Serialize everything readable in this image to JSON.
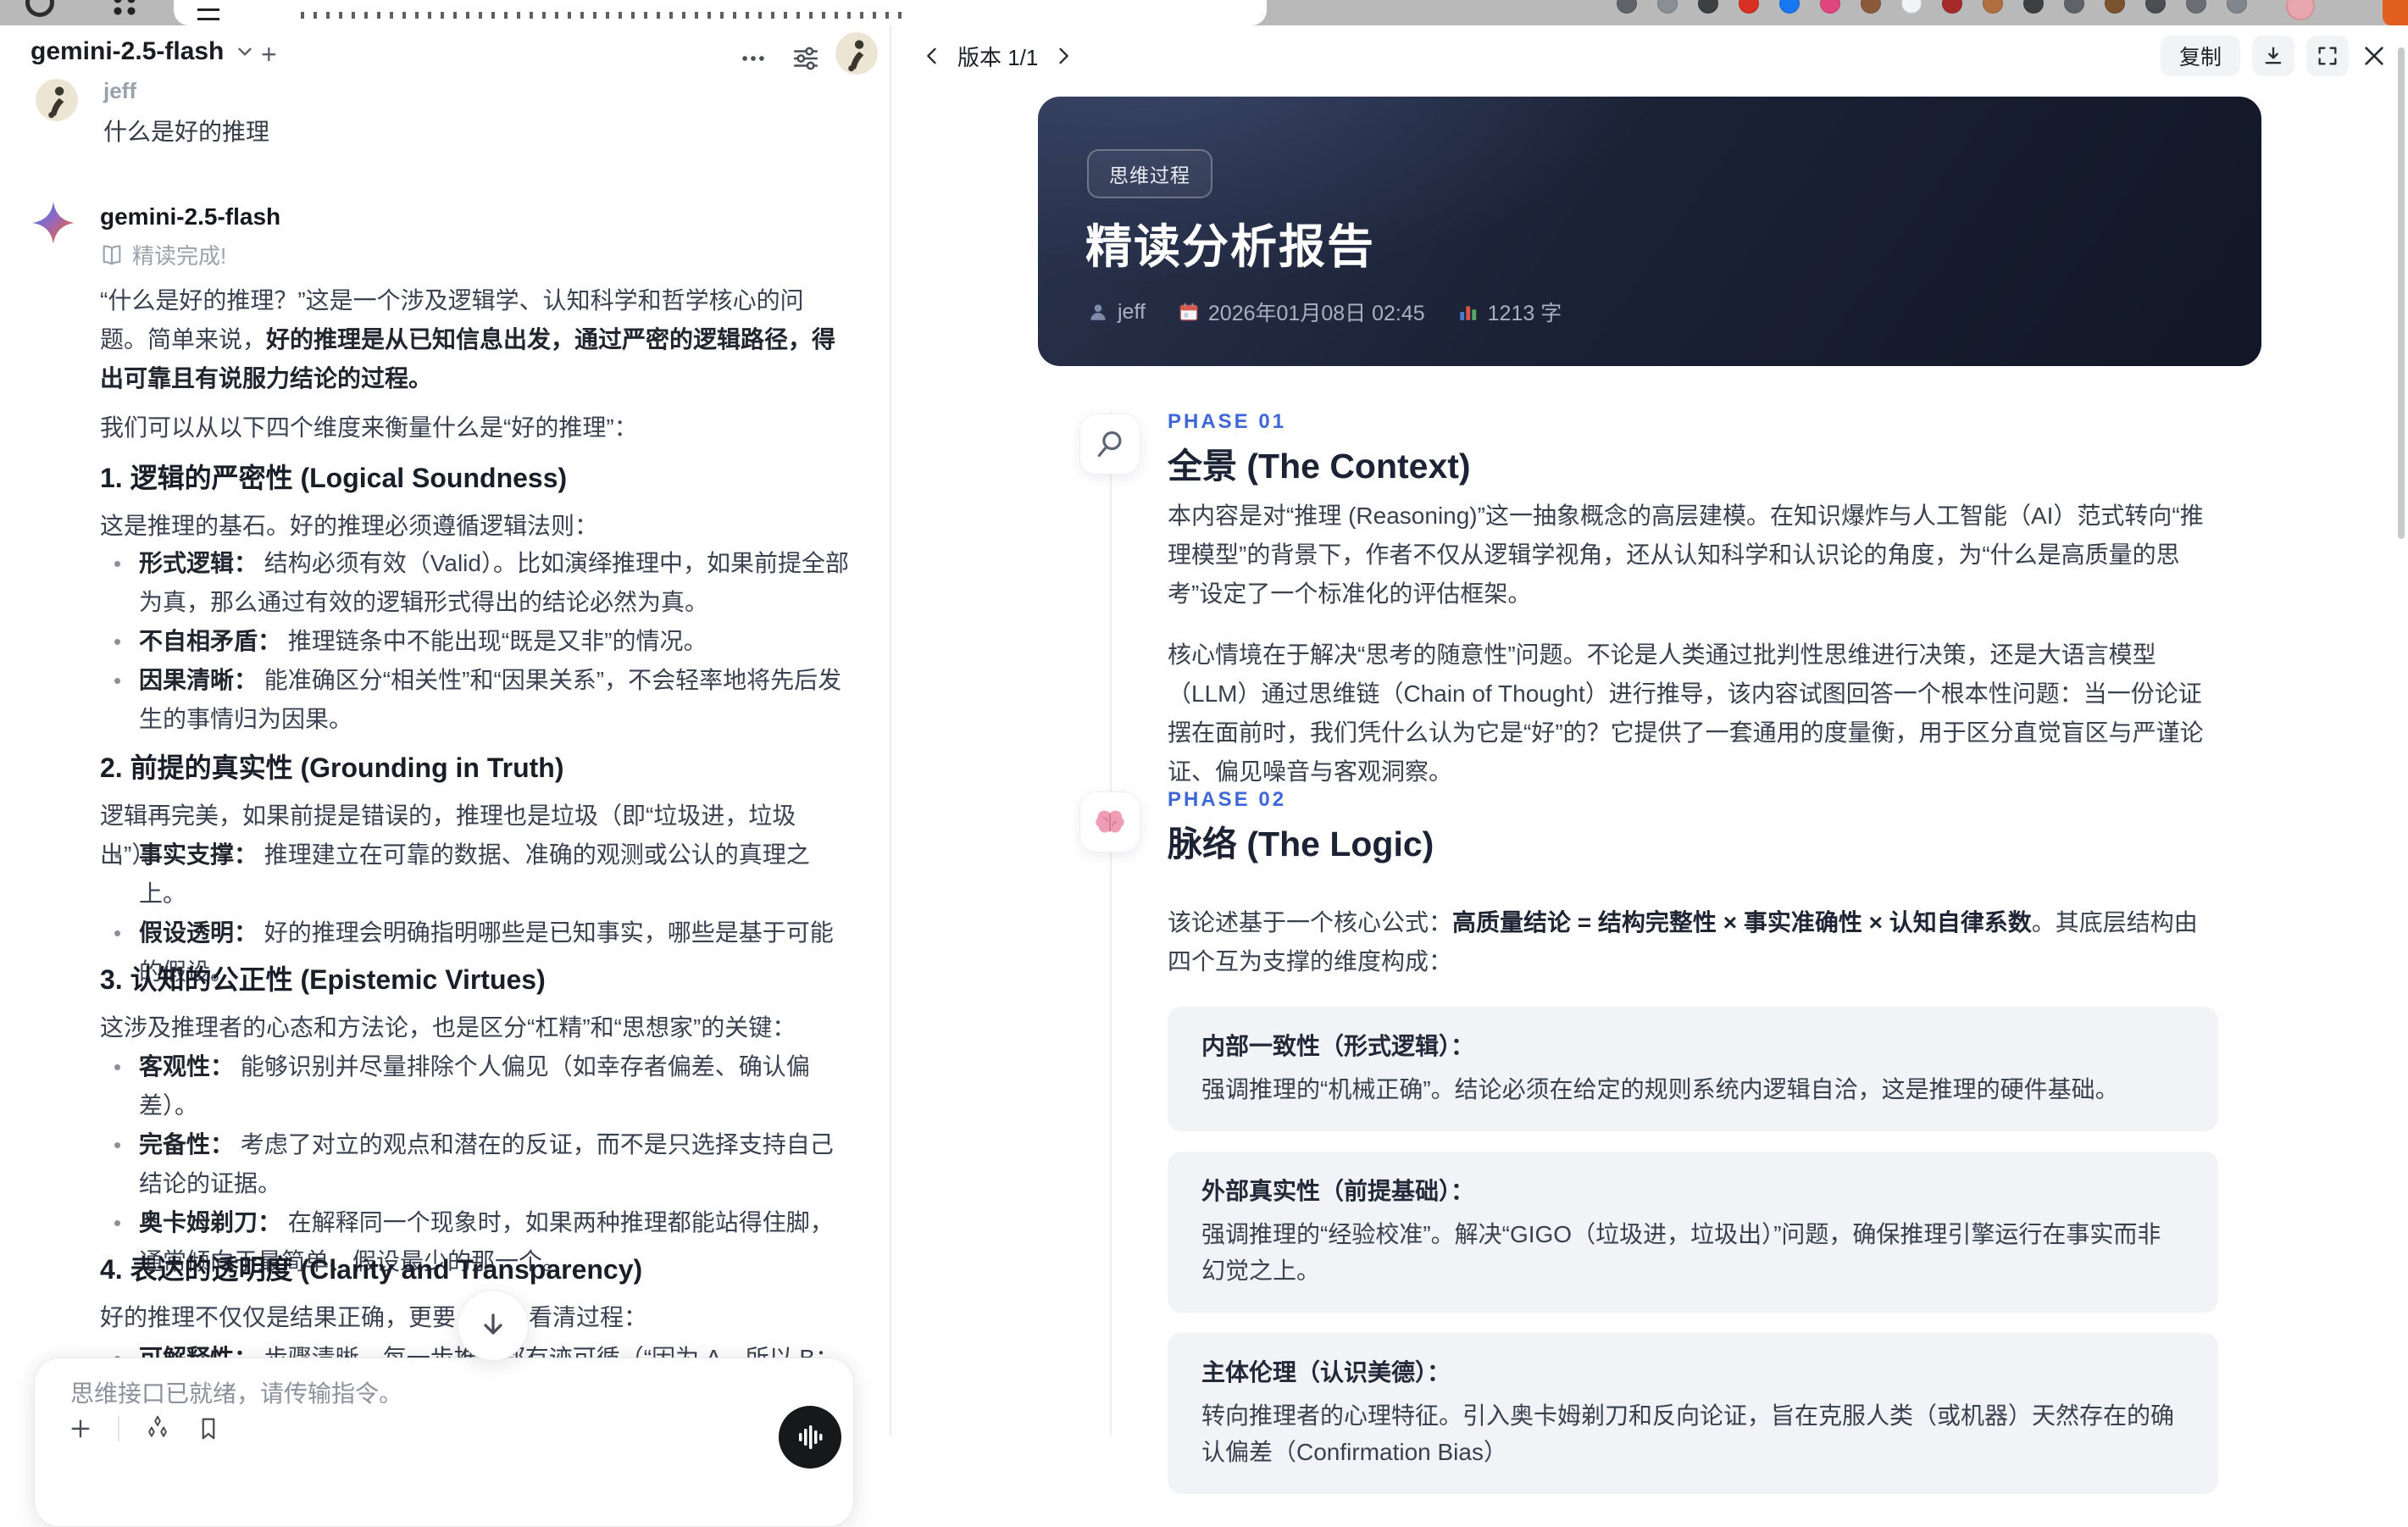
{
  "browser": {
    "extension_colors": [
      "#5f6368",
      "#8a8f94",
      "#3c4043",
      "#d93025",
      "#1877f2",
      "#e0457b",
      "#8a5a3b",
      "#f1f3f4",
      "#a52a2a",
      "#b06f3f",
      "#3c4043",
      "#5f6368",
      "#7a542e",
      "#4a4d52",
      "#6b6f74",
      "#80868b"
    ]
  },
  "chat": {
    "header": {
      "model_name": "gemini-2.5-flash",
      "new_chat_label": "+"
    },
    "user_message": {
      "author": "jeff",
      "text": "什么是好的推理"
    },
    "assistant": {
      "name": "gemini-2.5-flash",
      "status": "精读完成!",
      "intro_segments": [
        {
          "t": "“什么是好的推理？”这是一个涉及逻辑学、认知科学和哲学核心的问题。简单来说，"
        },
        {
          "t": "好的推理是从已知信息出发，通过严密的逻辑路径，得出可靠且有说服力结论的过程。",
          "b": true
        }
      ],
      "lead_line": "我们可以从以下四个维度来衡量什么是“好的推理”：",
      "sections": [
        {
          "heading": "1. 逻辑的严密性 (Logical Soundness)",
          "intro": "这是推理的基石。好的推理必须遵循逻辑法则：",
          "bullets": [
            {
              "term": "形式逻辑：",
              "rest": " 结构必须有效（Valid）。比如演绎推理中，如果前提全部为真，那么通过有效的逻辑形式得出的结论必然为真。"
            },
            {
              "term": "不自相矛盾：",
              "rest": " 推理链条中不能出现“既是又非”的情况。"
            },
            {
              "term": "因果清晰：",
              "rest": " 能准确区分“相关性”和“因果关系”，不会轻率地将先后发生的事情归为因果。"
            }
          ]
        },
        {
          "heading": "2. 前提的真实性 (Grounding in Truth)",
          "intro": "逻辑再完美，如果前提是错误的，推理也是垃圾（即“垃圾进，垃圾出”）。",
          "bullets": [
            {
              "term": "事实支撑：",
              "rest": " 推理建立在可靠的数据、准确的观测或公认的真理之上。"
            },
            {
              "term": "假设透明：",
              "rest": " 好的推理会明确指明哪些是已知事实，哪些是基于可能的假设。"
            }
          ]
        },
        {
          "heading": "3. 认知的公正性 (Epistemic Virtues)",
          "intro": "这涉及推理者的心态和方法论，也是区分“杠精”和“思想家”的关键：",
          "bullets": [
            {
              "term": "客观性：",
              "rest": " 能够识别并尽量排除个人偏见（如幸存者偏差、确认偏差）。"
            },
            {
              "term": "完备性：",
              "rest": " 考虑了对立的观点和潜在的反证，而不是只选择支持自己结论的证据。"
            },
            {
              "term": "奥卡姆剃刀：",
              "rest": " 在解释同一个现象时，如果两种推理都能站得住脚，通常倾向于最简单、假设最少的那一个。"
            }
          ]
        },
        {
          "heading": "4. 表达的透明度 (Clarity and Transparency)",
          "intro_pre": "好的推理不仅仅是结果正确，更要",
          "intro_post": "看清过程：",
          "partial_bullet": {
            "term": "可解释性：",
            "rest": " 步骤清晰，每一步推导都有迹可循（“因为 A，所以 B；基于 B"
          }
        }
      ]
    },
    "input": {
      "placeholder": "思维接口已就绪，请传输指令。"
    }
  },
  "report": {
    "toolbar": {
      "version_label": "版本 1/1",
      "copy_label": "复制"
    },
    "hero": {
      "badge": "思维过程",
      "title": "精读分析报告",
      "meta": {
        "author": "jeff",
        "date": "2026年01月08日 02:45",
        "word_count": "1213 字"
      }
    },
    "phases": [
      {
        "label": "PHASE 01",
        "title": "全景 (The Context)",
        "icon": "magnifier-icon",
        "paragraphs": [
          "本内容是对“推理 (Reasoning)”这一抽象概念的高层建模。在知识爆炸与人工智能（AI）范式转向“推理模型”的背景下，作者不仅从逻辑学视角，还从认知科学和认识论的角度，为“什么是高质量的思考”设定了一个标准化的评估框架。",
          "核心情境在于解决“思考的随意性”问题。不论是人类通过批判性思维进行决策，还是大语言模型（LLM）通过思维链（Chain of Thought）进行推导，该内容试图回答一个根本性问题：当一份论证摆在面前时，我们凭什么认为它是“好”的？它提供了一套通用的度量衡，用于区分直觉盲区与严谨论证、偏见噪音与客观洞察。"
        ]
      },
      {
        "label": "PHASE 02",
        "title": "脉络 (The Logic)",
        "icon": "brain-icon",
        "lead_segments": [
          {
            "t": "该论述基于一个核心公式："
          },
          {
            "t": "高质量结论 = 结构完整性 × 事实准确性 × 认知自律系数",
            "b": true
          },
          {
            "t": "。其底层结构由四个互为支撑的维度构成："
          }
        ],
        "cards": [
          {
            "title": "内部一致性（形式逻辑）：",
            "body": "强调推理的“机械正确”。结论必须在给定的规则系统内逻辑自洽，这是推理的硬件基础。"
          },
          {
            "title": "外部真实性（前提基础）：",
            "body": "强调推理的“经验校准”。解决“GIGO（垃圾进，垃圾出）”问题，确保推理引擎运行在事实而非幻觉之上。"
          },
          {
            "title": "主体伦理（认识美德）：",
            "body": "转向推理者的心理特征。引入奥卡姆剃刀和反向论证，旨在克服人类（或机器）天然存在的确认偏差（Confirmation Bias）"
          }
        ]
      }
    ]
  },
  "theme": {
    "accent_blue": "#3e68d8",
    "hero_bg_start": "#2a334d",
    "hero_bg_end": "#111726",
    "card_bg": "#f1f3f6",
    "browser_bar": "#b9b9b9"
  }
}
